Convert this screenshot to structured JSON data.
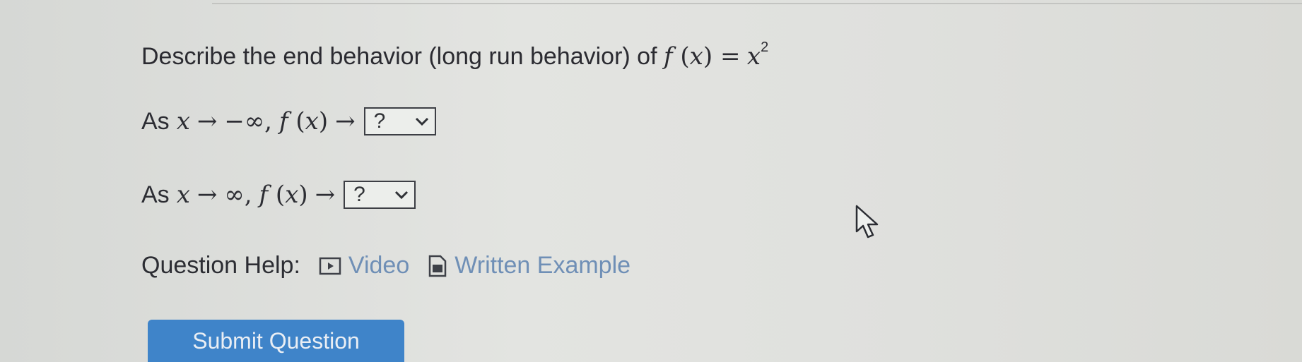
{
  "question": {
    "text": "Describe the end behavior (long run behavior) of",
    "func": "f",
    "var": "x",
    "equals": "=",
    "exponent": "2"
  },
  "rows": [
    {
      "prefix": "As",
      "var": "x",
      "arrow": "→",
      "limit": "−∞,",
      "func": "f",
      "dropdown_value": "?"
    },
    {
      "prefix": "As",
      "var": "x",
      "arrow": "→",
      "limit": "∞,",
      "func": "f",
      "dropdown_value": "?"
    }
  ],
  "help": {
    "label": "Question Help:",
    "video": "Video",
    "written_example": "Written Example"
  },
  "submit": {
    "label": "Submit Question"
  },
  "colors": {
    "link": "#6f8fb6",
    "button": "#3f84c9"
  }
}
